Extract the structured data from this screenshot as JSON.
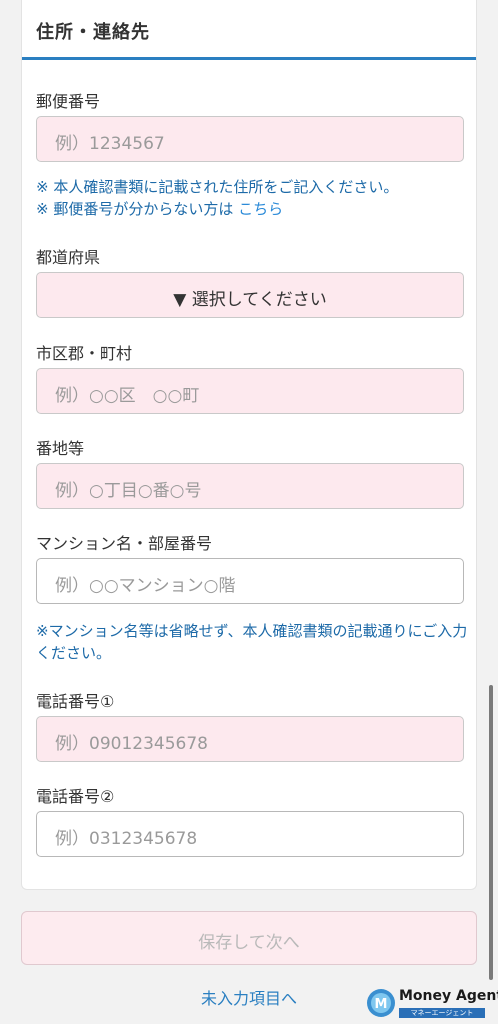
{
  "section": {
    "title": "住所・連絡先"
  },
  "postal": {
    "label": "郵便番号",
    "placeholder": "例）1234567"
  },
  "notes": {
    "address_note": "※ 本人確認書類に記載された住所をご記入ください。",
    "postal_unknown_prefix": "※ 郵便番号が分からない方は",
    "postal_unknown_link": "こちら",
    "mansion_note": "※マンション名等は省略せず、本人確認書類の記載通りにご入力ください。"
  },
  "prefecture": {
    "label": "都道府県",
    "selected": "▼ 選択してください"
  },
  "city": {
    "label": "市区郡・町村",
    "placeholder": "例）○○区　○○町"
  },
  "street": {
    "label": "番地等",
    "placeholder": "例）○丁目○番○号"
  },
  "building": {
    "label": "マンション名・部屋番号",
    "placeholder": "例）○○マンション○階"
  },
  "phone1": {
    "label": "電話番号①",
    "placeholder": "例）09012345678"
  },
  "phone2": {
    "label": "電話番号②",
    "placeholder": "例）0312345678"
  },
  "actions": {
    "save_label": "保存して次へ",
    "unfilled_link": "未入力項目へ"
  },
  "brand": {
    "name": "Money Agent",
    "subtitle": "マネーエージェント"
  },
  "colors": {
    "accent": "#2a7fc1",
    "required_field_bg": "#fde9ee",
    "note_text": "#1d6aa8"
  }
}
